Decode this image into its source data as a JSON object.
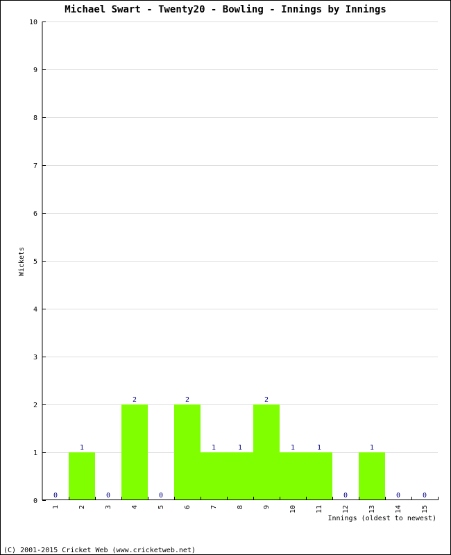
{
  "chart_data": {
    "type": "bar",
    "title": "Michael Swart - Twenty20 - Bowling - Innings by Innings",
    "xlabel": "Innings (oldest to newest)",
    "ylabel": "Wickets",
    "categories": [
      "1",
      "2",
      "3",
      "4",
      "5",
      "6",
      "7",
      "8",
      "9",
      "10",
      "11",
      "12",
      "13",
      "14",
      "15"
    ],
    "values": [
      0,
      1,
      0,
      2,
      0,
      2,
      1,
      1,
      2,
      1,
      1,
      0,
      1,
      0,
      0
    ],
    "ylim": [
      0,
      10
    ],
    "yticks": [
      0,
      1,
      2,
      3,
      4,
      5,
      6,
      7,
      8,
      9,
      10
    ],
    "grid": true,
    "legend": "none",
    "bar_color": "#80ff00",
    "value_label_color": "#000080"
  },
  "footer": "(C) 2001-2015 Cricket Web (www.cricketweb.net)"
}
